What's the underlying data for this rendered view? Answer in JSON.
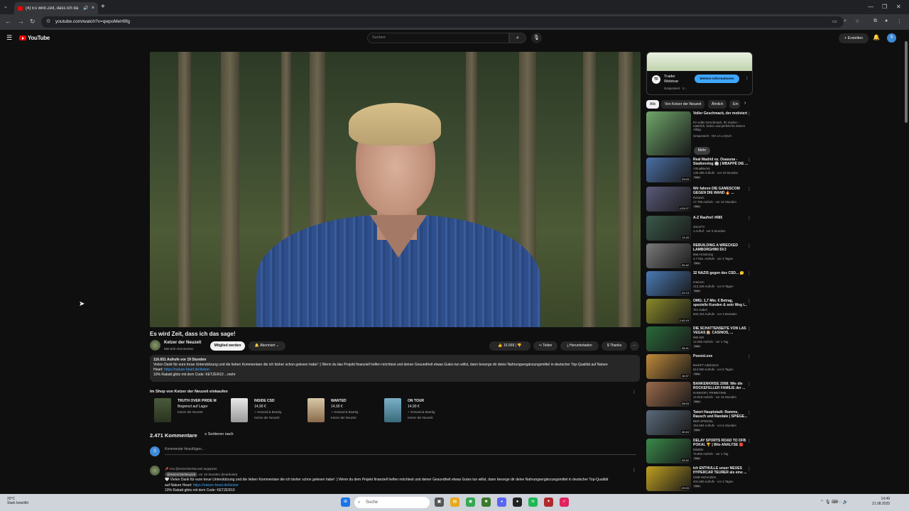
{
  "browser": {
    "tab_title": "(4) Es wird Zeit, dass ich da",
    "url": "youtube.com/watch?v=qwpoMeH9fg"
  },
  "masthead": {
    "logo_text": "YouTube",
    "search_placeholder": "Suchen",
    "create_label": "Erstellen",
    "avatar_letter": "S"
  },
  "video": {
    "title": "Es wird Zeit, dass ich das sage!",
    "channel": "Ketzer der Neuzeit",
    "subscribers": "560.000 Abonnenten",
    "join_label": "Mitglied werden",
    "subscribe_label": "Abonniert",
    "likes": "16.569",
    "share_label": "Teilen",
    "download_label": "Herunterladen",
    "thanks_label": "Thanks",
    "description": {
      "views_line": "116.651 Aufrufe  vor 19 Stunden",
      "text": "Vielen Dank für eure treue Unterstützung und die lieben Kommentare die ich bisher schon gelesen habe! :) Wenn du das Projekt finanziell helfen möchtest und deiner Gesundheit etwas Gutes tun willst, dann besorge dir deine Nahrungsergänzungsmittel in deutscher Top-Qualität auf Nature",
      "text2": "Heart: ",
      "link": "https://nature-heart.de/ketzer",
      "code_line": "10% Rabatt gibts mit dem Code: KETZER10 ...mehr"
    }
  },
  "shop": {
    "heading": "Im Shop von Ketzer der Neuzeit einkaufen",
    "items": [
      {
        "name": "TRUTH OVER PRIDE M",
        "line2": "Begrenzt auf Lager",
        "seller": "Ketzer der Neuzeit"
      },
      {
        "name": "INSIDE CSD",
        "line2": "14,90 €",
        "ship": "+ Versand & Beartig",
        "seller": "Ketzer der Neuzeit"
      },
      {
        "name": "WANTED",
        "line2": "14,90 €",
        "ship": "+ Versand & Beartig",
        "seller": "Ketzer der Neuzeit"
      },
      {
        "name": "ON TOUR",
        "line2": "14,90 €",
        "ship": "+ Versand & Beartig",
        "seller": "Ketzer der Neuzeit"
      }
    ]
  },
  "comments": {
    "count": "2.471 Kommentare",
    "sort_label": "Sortieren nach",
    "add_placeholder": "Kommentar hinzufügen...",
    "my_avatar": "S",
    "first": {
      "pinned": "Von @KetzerDerNeuzeit angepinnt",
      "author": "@KetzerDerNeuzeit",
      "time": "vor 19 Stunden (bearbeitet)",
      "text": "Vielen Dank für eure treue Unterstützung und die lieben Kommentare die ich bisher schon gelesen habe! :) Wenn du dem Projekt finanziell helfen möchtest und deiner Gesundheit etwas Gutes tun willst, dann besorge dir deine Nahrungsergänzungsmittel in deutscher Top-Qualität",
      "text2": "auf Nature Heart: ",
      "link": "https://nature-heart.de/ketzer",
      "code": "10% Rabatt gibts mit dem Code: KETZER10"
    }
  },
  "ad": {
    "title_line1": "Trader",
    "title_line2": "Webinar",
    "sponsored": "Gesponsert · V...",
    "button": "Weitere Informationen"
  },
  "chips": [
    "Alle",
    "Von Ketzer der Neuzeit",
    "Ähnlich",
    "Em"
  ],
  "recommendations": [
    {
      "title": "Voller Geschmack, der motiviert",
      "channel": "Ihr voller Geschmack, Ihr Zucker – natürlich, lecker und perfekt für deinen Alltag",
      "meta": "Gesponsert · OH LA LAQUA",
      "duration": "",
      "color": "#6fa66a"
    },
    {
      "title": "Real Madrid vs. Osasuna - Stadionvlog 🏟 | MBAPPÉ DIE ...",
      "channel": "VirtualBecks",
      "meta": "135.366 Aufrufe · vor 23 Stunden",
      "duration": "29:03",
      "color": "#4a6fa5"
    },
    {
      "title": "Wir fahren DIE GAMESCOM GEGEN DIE WAND 🔥 ...",
      "channel": "Rohavis",
      "meta": "17.796 Aufrufe · vor 16 Stunden",
      "duration": "4:29:27",
      "color": "#5a5a7a"
    },
    {
      "title": "A-Z Raufrei! #085",
      "channel": "visionTV",
      "meta": "1 Aufruf · vor 6 Stunden",
      "duration": "11:43",
      "color": "#3a5a4a"
    },
    {
      "title": "REBUILDING A WRECKED LAMBORGHINI SVJ",
      "channel": "Mat Armstrong",
      "meta": "4,7 Mio. Aufrufe · vor 3 Tagen",
      "duration": "30:42",
      "color": "#7a7a7a"
    },
    {
      "title": "32 NAZIS gegen des CSD... 🤔",
      "channel": "marcem",
      "meta": "213.349 Aufrufe · vor 9 Tagen",
      "duration": "22:13",
      "color": "#4a7ab5"
    },
    {
      "title": "OMG: 1,7 Mio. € Betrag, spezielle Kunden & sein Weg i...",
      "channel": "Tim Gabel",
      "meta": "602.323 Aufrufe · vor 4 Monaten",
      "duration": "2:42:19",
      "color": "#8a8a2a"
    },
    {
      "title": "DIE SCHATTENSEITE VON LAS VEGAS 🎰 CASINOS, ...",
      "channel": "999 SiR",
      "meta": "12.082 Aufrufe · vor 1 Tag",
      "duration": "28:41",
      "color": "#2a6a3a"
    },
    {
      "title": "Poesisi.exe",
      "channel": "BushFT Addictions",
      "meta": "813.960 Aufrufe · vor 5 Tagen",
      "duration": "16:37",
      "color": "#c08a3a"
    },
    {
      "title": "BANKENKRISE 2008: Wie die ROCKEFELLER FAMILIE der ...",
      "channel": "RAMHOR | PRIMETIME",
      "meta": "12.919 Aufrufe · vor 16 Stunden",
      "duration": "28:03",
      "color": "#9a6a4a"
    },
    {
      "title": "Tatort Hauptstadt: Ramme, Rausch und Randale | SPIEGE...",
      "channel": "DER SPIEGEL",
      "meta": "154.684 Aufrufe · vor 6 Stunden",
      "duration": "40:44",
      "color": "#5a6a7a"
    },
    {
      "title": "DELAY SPORTS ROAD TO DFB POKAL 🏆 | Bilo ANALYSE 🔴",
      "channel": "BiloBilo",
      "meta": "76.894 Aufrufe · vor 1 Tag",
      "duration": "33:32",
      "color": "#3a8a4a"
    },
    {
      "title": "Ich ENTHÜLLE unser NEUES HYPERCAR TEURER als eine ...",
      "channel": "GMD MOVAZEN",
      "meta": "201.660 Aufrufe · vor 2 Tagen",
      "duration": "20:03",
      "color": "#c0a020"
    }
  ],
  "more_label": "Mehr",
  "badge_new": "Neu",
  "taskbar": {
    "weather_temp": "20°C",
    "weather_desc": "Stark bewölkt",
    "search": "Suche",
    "time": "14:49",
    "date": "21.08.2025"
  }
}
